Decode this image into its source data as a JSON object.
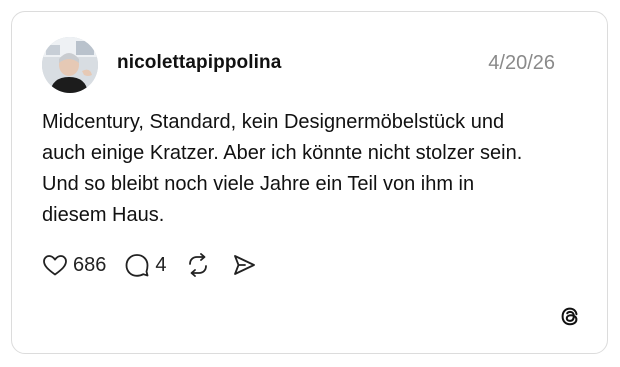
{
  "post": {
    "username": "nicolettapippolina",
    "date": "4/20/26",
    "text": "Midcentury, Standard, kein Designermöbelstück und auch einige Kratzer. Aber ich könnte nicht stolzer sein. Und so bleibt noch viele Jahre ein Teil von ihm in diesem Haus.",
    "likes": "686",
    "replies": "4"
  },
  "icons": {
    "like": "heart-icon",
    "reply": "comment-bubble-icon",
    "repost": "repost-arrows-icon",
    "share": "send-icon",
    "brand": "threads-logo-icon"
  },
  "colors": {
    "border": "#dcdcdc",
    "text": "#101010",
    "muted": "#8a8a8a"
  }
}
